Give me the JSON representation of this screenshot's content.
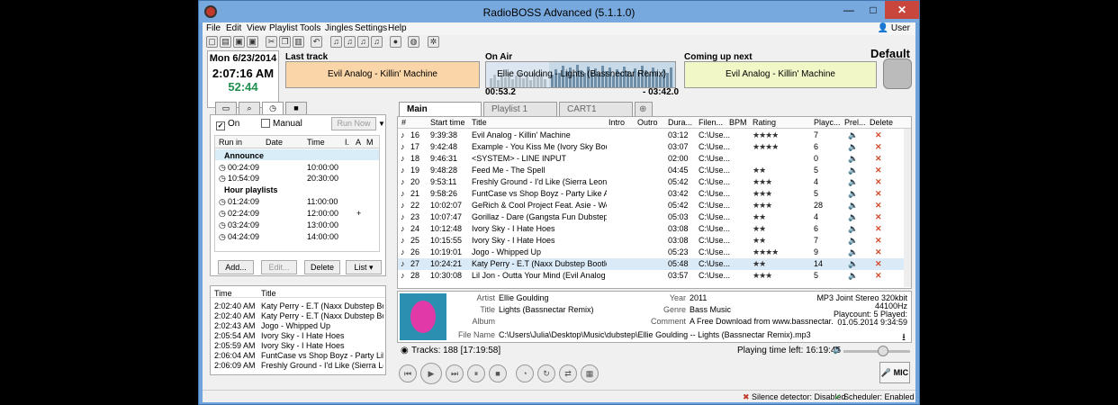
{
  "window": {
    "title": "RadioBOSS Advanced (5.1.1.0)",
    "min": "—",
    "max": "□",
    "close": "✕"
  },
  "menu": [
    "File",
    "Edit",
    "View",
    "Playlist",
    "Tools",
    "Jingles",
    "Settings",
    "Help"
  ],
  "user": "User",
  "profile": "Default",
  "clock": {
    "date": "Mon 6/23/2014",
    "time": "2:07:16 AM",
    "countdown": "52:44"
  },
  "last_track": {
    "label": "Last track",
    "title": "Evil Analog - Killin' Machine"
  },
  "on_air": {
    "label": "On Air",
    "title": "Ellie Goulding - Lights (Bassnectar Remix)",
    "elapsed": "00:53.2",
    "remaining": "- 03:42.0"
  },
  "coming_next": {
    "label": "Coming up next",
    "title": "Evil Analog - Killin' Machine"
  },
  "scheduler": {
    "on_label": "On",
    "manual_label": "Manual",
    "run_now": "Run Now",
    "cols": [
      "Run in",
      "Date",
      "Time",
      "I.",
      "A",
      "M"
    ],
    "groups": [
      {
        "name": "Announce",
        "rows": [
          {
            "run": "00:24:09",
            "time": "10:00:00",
            "flag": ""
          },
          {
            "run": "10:54:09",
            "time": "20:30:00",
            "flag": ""
          }
        ]
      },
      {
        "name": "Hour playlists",
        "rows": [
          {
            "run": "01:24:09",
            "time": "11:00:00",
            "flag": ""
          },
          {
            "run": "02:24:09",
            "time": "12:00:00",
            "flag": "+"
          },
          {
            "run": "03:24:09",
            "time": "13:00:00",
            "flag": ""
          },
          {
            "run": "04:24:09",
            "time": "14:00:00",
            "flag": ""
          }
        ]
      }
    ],
    "buttons": [
      "Add...",
      "Edit...",
      "Delete",
      "List"
    ]
  },
  "history": {
    "cols": [
      "Time",
      "Title"
    ],
    "rows": [
      {
        "t": "2:02:40 AM",
        "title": "Katy Perry - E.T (Naxx Dubstep Bootleg)"
      },
      {
        "t": "2:02:40 AM",
        "title": "Katy Perry - E.T (Naxx Dubstep Bootleg)"
      },
      {
        "t": "2:02:43 AM",
        "title": "Jogo - Whipped Up"
      },
      {
        "t": "2:05:54 AM",
        "title": "Ivory Sky - I Hate Hoes"
      },
      {
        "t": "2:05:59 AM",
        "title": "Ivory Sky - I Hate Hoes"
      },
      {
        "t": "2:06:04 AM",
        "title": "FuntCase vs Shop Boyz - Party Like A Fuc"
      },
      {
        "t": "2:06:09 AM",
        "title": "Freshly Ground - I'd Like  (Sierra Leone M"
      }
    ]
  },
  "playlist_tabs": [
    "Main",
    "Playlist 1",
    "CART1"
  ],
  "playlist": {
    "cols": [
      "#",
      "Start time",
      "Title",
      "Intro",
      "Outro",
      "Dura...",
      "Filen...",
      "BPM",
      "Rating",
      "Playc...",
      "Prel...",
      "Delete"
    ],
    "rows": [
      {
        "n": "16",
        "start": "9:39:38",
        "title": "Evil Analog - Killin' Machine",
        "dur": "03:12",
        "file": "C:\\Use...",
        "rating": "★★★★",
        "plays": "7"
      },
      {
        "n": "17",
        "start": "9:42:48",
        "title": "Example - You Kiss Me (Ivory Sky Bootleg)",
        "dur": "03:07",
        "file": "C:\\Use...",
        "rating": "★★★★",
        "plays": "6"
      },
      {
        "n": "18",
        "start": "9:46:31",
        "title": "<SYSTEM> - LINE INPUT",
        "dur": "02:00",
        "file": "C:\\Use...",
        "rating": "",
        "plays": "0"
      },
      {
        "n": "19",
        "start": "9:48:28",
        "title": "Feed Me - The Spell",
        "dur": "04:45",
        "file": "C:\\Use...",
        "rating": "★★",
        "plays": "5"
      },
      {
        "n": "20",
        "start": "9:53:11",
        "title": "Freshly Ground - I'd Like  (Sierra Leone Mt E...",
        "dur": "05:42",
        "file": "C:\\Use...",
        "rating": "★★★",
        "plays": "4"
      },
      {
        "n": "21",
        "start": "9:58:26",
        "title": "FuntCase vs Shop Boyz - Party Like A Fuck's...",
        "dur": "03:42",
        "file": "C:\\Use...",
        "rating": "★★★",
        "plays": "5"
      },
      {
        "n": "22",
        "start": "10:02:07",
        "title": "GeRich & Cool Project Feat. Asie - We Are B...",
        "dur": "05:42",
        "file": "C:\\Use...",
        "rating": "★★★",
        "plays": "28"
      },
      {
        "n": "23",
        "start": "10:07:47",
        "title": "Gorillaz - Dare (Gangsta Fun Dubstep Mix)",
        "dur": "05:03",
        "file": "C:\\Use...",
        "rating": "★★",
        "plays": "4"
      },
      {
        "n": "24",
        "start": "10:12:48",
        "title": "Ivory Sky - I Hate Hoes",
        "dur": "03:08",
        "file": "C:\\Use...",
        "rating": "★★",
        "plays": "6"
      },
      {
        "n": "25",
        "start": "10:15:55",
        "title": "Ivory Sky - I Hate Hoes",
        "dur": "03:08",
        "file": "C:\\Use...",
        "rating": "★★",
        "plays": "7"
      },
      {
        "n": "26",
        "start": "10:19:01",
        "title": "Jogo - Whipped Up",
        "dur": "05:23",
        "file": "C:\\Use...",
        "rating": "★★★★",
        "plays": "9"
      },
      {
        "n": "27",
        "start": "10:24:21",
        "title": "Katy Perry - E.T (Naxx Dubstep Bootleg)",
        "dur": "05:48",
        "file": "C:\\Use...",
        "rating": "★★",
        "plays": "14"
      },
      {
        "n": "28",
        "start": "10:30:08",
        "title": "Lil Jon - Outta Your Mind (Evil Analog dubste...",
        "dur": "03:57",
        "file": "C:\\Use...",
        "rating": "★★★",
        "plays": "5"
      }
    ]
  },
  "track_info": {
    "artist_k": "Artist",
    "artist": "Ellie Goulding",
    "title_k": "Title",
    "title": "Lights (Bassnectar Remix)",
    "album_k": "Album",
    "album": "",
    "year_k": "Year",
    "year": "2011",
    "genre_k": "Genre",
    "genre": "Bass Music",
    "comment_k": "Comment",
    "comment": "A Free Download from www.bassnectar.net - Enjc",
    "file_k": "File Name",
    "file": "C:\\Users\\Julia\\Desktop\\Music\\dubstep\\Ellie Goulding -- Lights (Bassnectar Remix).mp3",
    "format": "MP3 Joint Stereo 320kbit",
    "rate": "44100Hz",
    "playcount": "Playcount: 5  Played:",
    "played": "01.05.2014 9:34:59"
  },
  "status": {
    "tracks": "Tracks: 188 [17:19:58]",
    "left": "Playing time left: 16:19:45"
  },
  "mic": "MIC",
  "statusbar": {
    "silence": "Silence detector: Disabled",
    "scheduler": "Scheduler: Enabled"
  }
}
